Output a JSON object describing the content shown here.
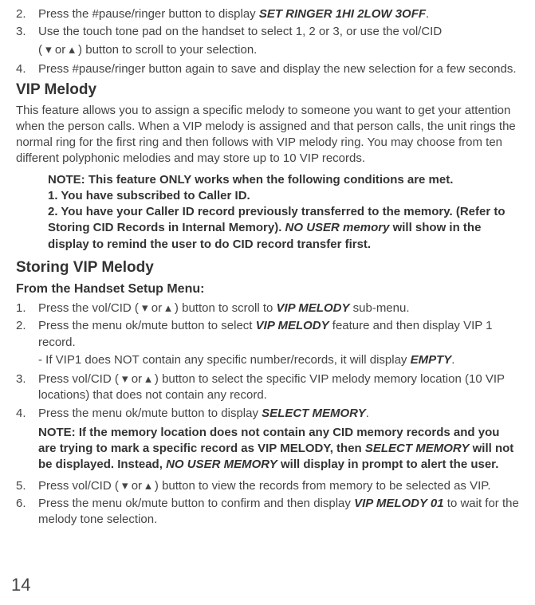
{
  "items_top": {
    "i2_num": "2.",
    "i2_a": "Press the #pause/ringer button to display ",
    "i2_b": "SET RINGER 1HI 2LOW 3OFF",
    "i2_c": ".",
    "i3_num": "3.",
    "i3_a": "Use the touch tone pad on the handset to select 1, 2 or 3, or use the vol/CID",
    "i3_sub": "( ▾ or ▴ ) button to scroll to your selection.",
    "i4_num": "4.",
    "i4_a": "Press #pause/ringer button again to save and display the new selection for a few seconds."
  },
  "heading1": "VIP Melody",
  "para1": "This feature allows you to assign a specific melody to someone you want to get your attention when the person calls. When a VIP melody is assigned and that person calls, the unit rings the normal ring for the first ring and then follows with VIP melody ring. You may choose from ten different polyphonic melodies and may store up to 10 VIP records.",
  "note1": {
    "l1": "NOTE: This feature ONLY works when the following conditions are met.",
    "l2": "1. You have subscribed to Caller ID.",
    "l3a": "2. You have your Caller ID record previously transferred to the memory. (Refer to Storing CID Records in Internal Memory). ",
    "l3b": "NO USER memory",
    "l3c": " will show in the display to remind the user to do CID record transfer first."
  },
  "heading2": "Storing VIP Melody",
  "subhead": "From the Handset Setup Menu:",
  "steps": {
    "s1_num": "1.",
    "s1_a": "Press the vol/CID ( ▾ or ▴ ) button to scroll to ",
    "s1_b": "VIP MELODY",
    "s1_c": " sub-menu.",
    "s2_num": "2.",
    "s2_a": "Press the menu ok/mute button to select ",
    "s2_b": "VIP MELODY",
    "s2_c": " feature and then display VIP 1 record.",
    "s2_sub_a": "- If VIP1 does NOT contain any specific number/records, it will display ",
    "s2_sub_b": "EMPTY",
    "s2_sub_c": ".",
    "s3_num": "3.",
    "s3_a": "Press vol/CID ( ▾ or ▴ ) button to select the specific VIP melody memory location (10 VIP locations) that does not contain any record.",
    "s4_num": "4.",
    "s4_a": "Press the menu ok/mute button to display ",
    "s4_b": "SELECT MEMORY",
    "s4_c": "."
  },
  "note2": {
    "a": "NOTE: If the memory location does not contain any CID memory records and you are trying to mark a specific record as VIP MELODY, then ",
    "b": "SELECT MEMORY",
    "c": " will not be displayed. Instead, ",
    "d": "NO USER MEMORY",
    "e": " will display in prompt to alert the user."
  },
  "steps2": {
    "s5_num": "5.",
    "s5_a": "Press vol/CID ( ▾ or ▴ ) button to view the records from memory to be selected as VIP.",
    "s6_num": "6.",
    "s6_a": "Press the menu ok/mute button to confirm and then display ",
    "s6_b": "VIP MELODY 01",
    "s6_c": " to wait for the melody tone selection."
  },
  "page_num": "14"
}
